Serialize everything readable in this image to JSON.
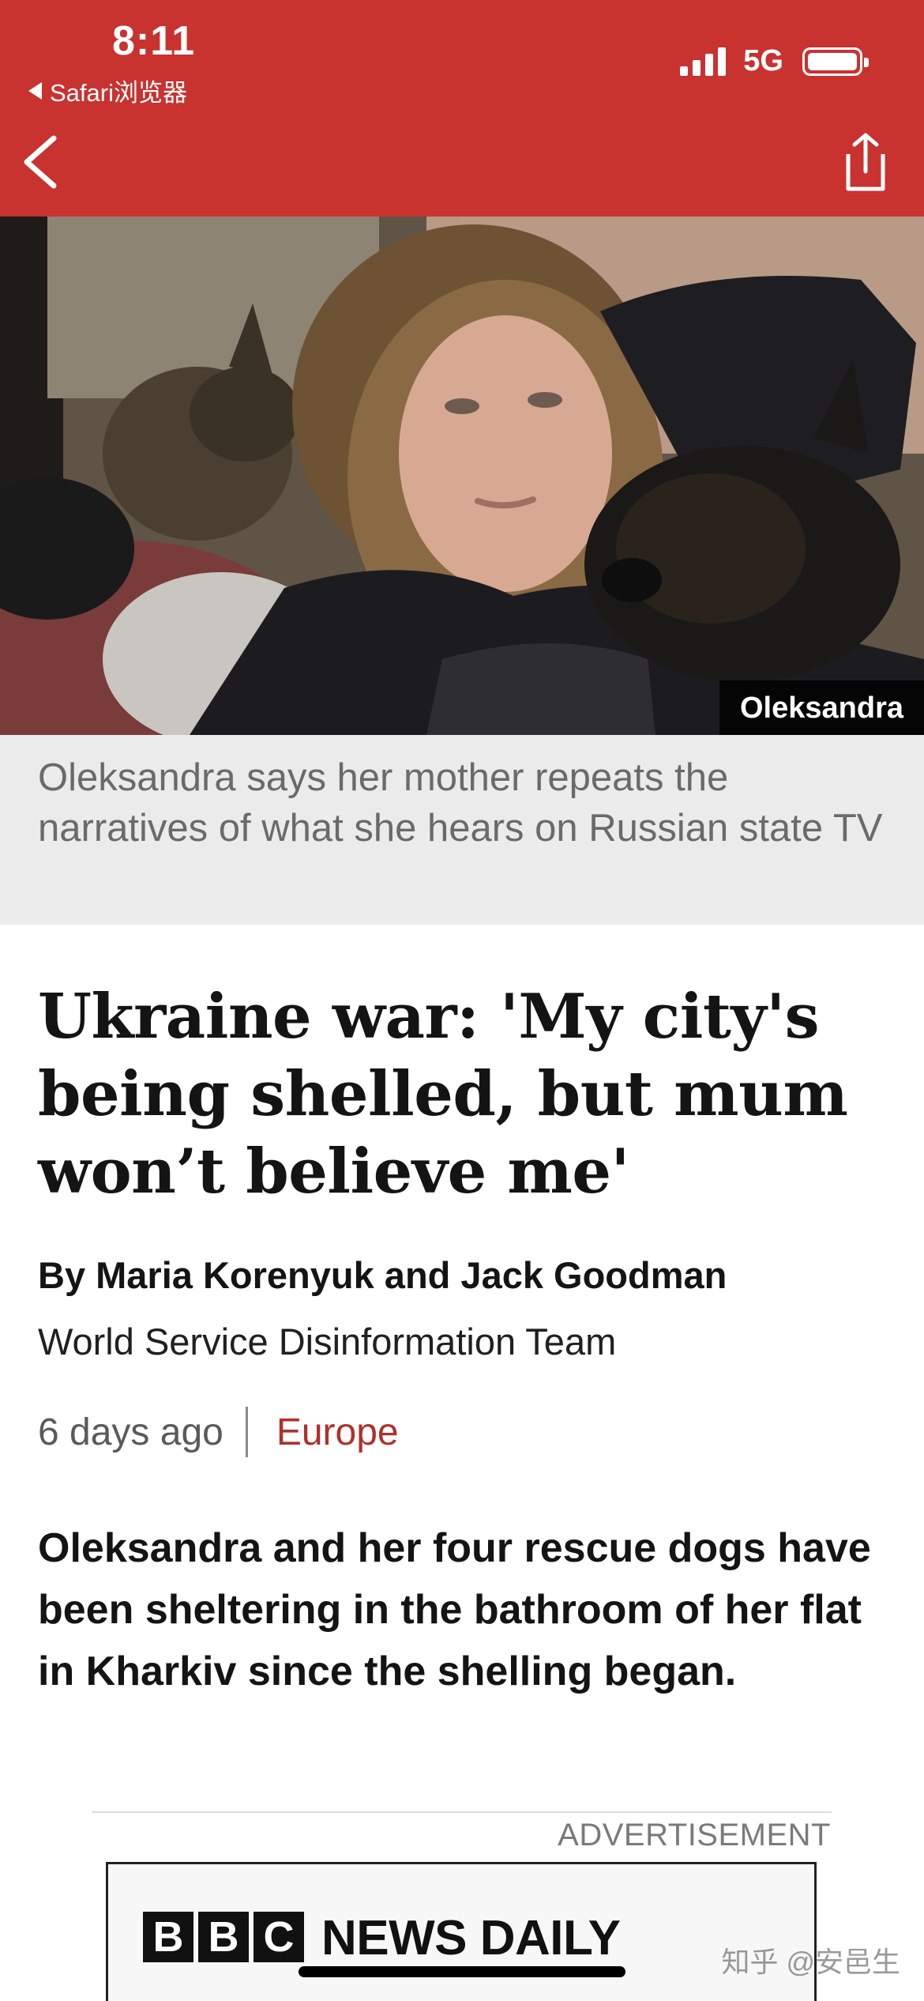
{
  "status_bar": {
    "time": "8:11",
    "back_app": "Safari浏览器",
    "network": "5G",
    "battery_level": 1.0
  },
  "nav": {
    "back_icon": "chevron-left-icon",
    "share_icon": "share-icon"
  },
  "hero": {
    "credit": "Oleksandra"
  },
  "caption": "Oleksandra says her mother repeats the narratives of what she hears on Russian state TV",
  "article": {
    "headline": "Ukraine war: 'My city's being shelled, but mum won’t believe me'",
    "byline": "By Maria Korenyuk and Jack Goodman",
    "team": "World Service Disinformation Team",
    "date": "6 days ago",
    "section": "Europe",
    "intro": "Oleksandra and her four rescue dogs have been sheltering in the bathroom of her flat in Kharkiv since the shelling began."
  },
  "advertisement": {
    "label": "ADVERTISEMENT",
    "bbc_letters": [
      "B",
      "B",
      "C"
    ],
    "title": "NEWS DAILY"
  },
  "watermark": "知乎 @安邑生",
  "colors": {
    "header_red": "#c8322f",
    "section_link": "#b0302c",
    "caption_bg": "#ebebeb"
  }
}
